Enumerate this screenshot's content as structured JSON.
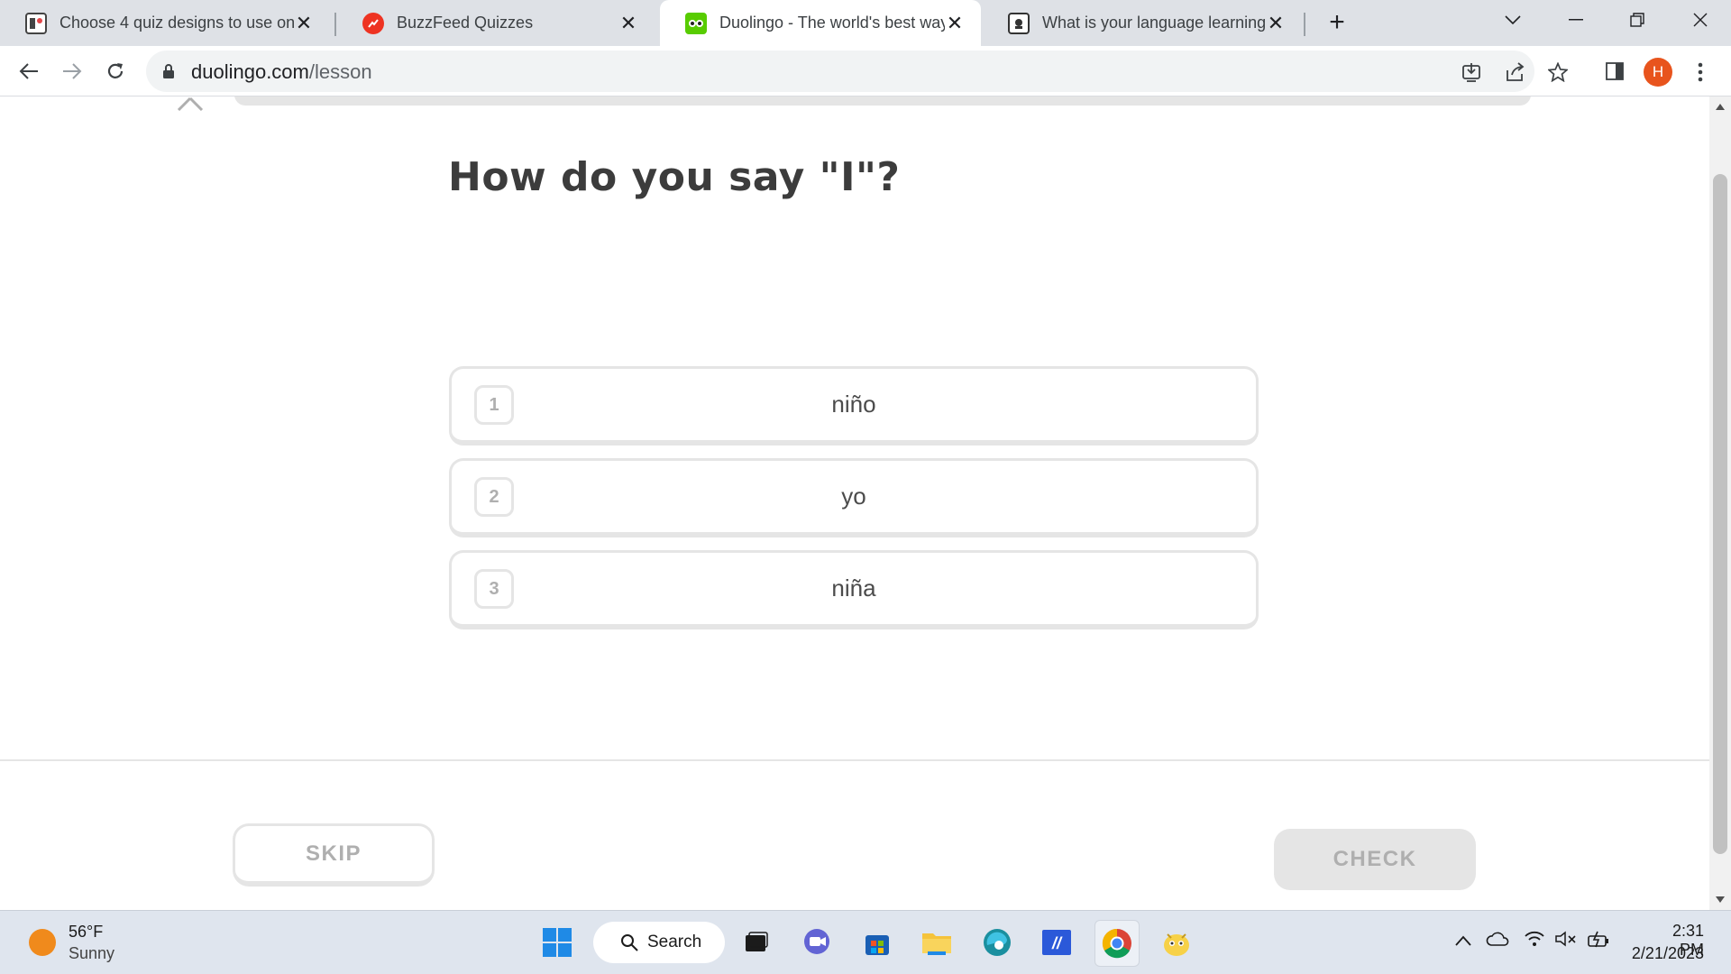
{
  "browser": {
    "tabs": [
      {
        "title": "Choose 4 quiz designs to use on",
        "favicon": "quiz-design-favicon",
        "active": false
      },
      {
        "title": "BuzzFeed Quizzes",
        "favicon": "buzzfeed-favicon",
        "active": false
      },
      {
        "title": "Duolingo - The world's best way",
        "favicon": "duolingo-favicon",
        "active": true
      },
      {
        "title": "What is your language learning s",
        "favicon": "quiz-favicon",
        "active": false
      }
    ],
    "url": {
      "domain": "duolingo.com",
      "path": "/lesson"
    },
    "profile_initial": "H"
  },
  "lesson": {
    "question": "How do you say \"I\"?",
    "choices": [
      {
        "number": "1",
        "text": "niño"
      },
      {
        "number": "2",
        "text": "yo"
      },
      {
        "number": "3",
        "text": "niña"
      }
    ],
    "skip_label": "SKIP",
    "check_label": "CHECK"
  },
  "taskbar": {
    "weather": {
      "temp": "56°F",
      "condition": "Sunny"
    },
    "search_label": "Search",
    "clock": {
      "time": "2:31 PM",
      "date": "2/21/2023"
    }
  },
  "colors": {
    "border": "#e5e5e5",
    "muted_text": "#afafaf",
    "question_text": "#3c3c3c",
    "duolingo_green": "#58cc02",
    "profile_orange": "#e8541d"
  }
}
